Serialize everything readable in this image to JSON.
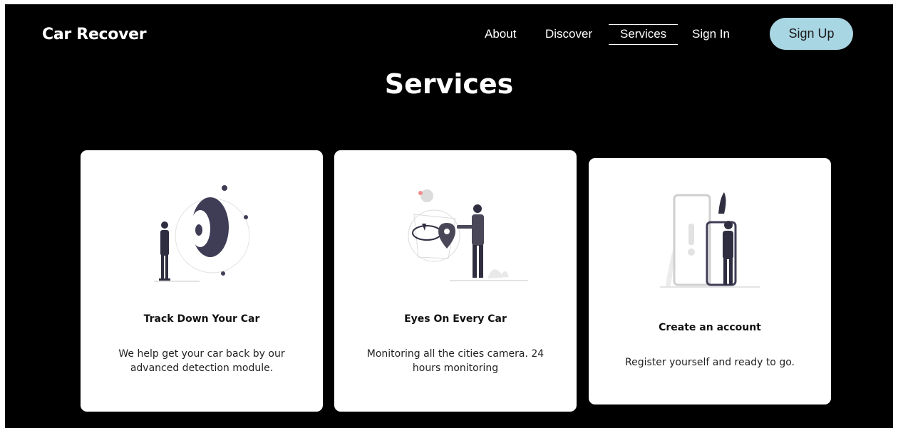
{
  "brand": {
    "name": "Car Recover"
  },
  "nav": {
    "links": [
      "About",
      "Discover",
      "Services",
      "Sign In"
    ],
    "active": "Services",
    "signup_label": "Sign Up"
  },
  "page": {
    "heading": "Services"
  },
  "services": [
    {
      "title": "Track Down Your Car",
      "description": "We help get your car back by our advanced detection module.",
      "icon": "camera-lens-person-illustration"
    },
    {
      "title": "Eyes On Every Car",
      "description": "Monitoring all the cities camera. 24 hours monitoring",
      "icon": "map-pin-person-illustration"
    },
    {
      "title": "Create an account",
      "description": "Register yourself and ready to go.",
      "icon": "phone-signup-person-illustration"
    }
  ],
  "colors": {
    "background": "#000000",
    "card": "#ffffff",
    "signup_button": "#a9d6e3"
  }
}
